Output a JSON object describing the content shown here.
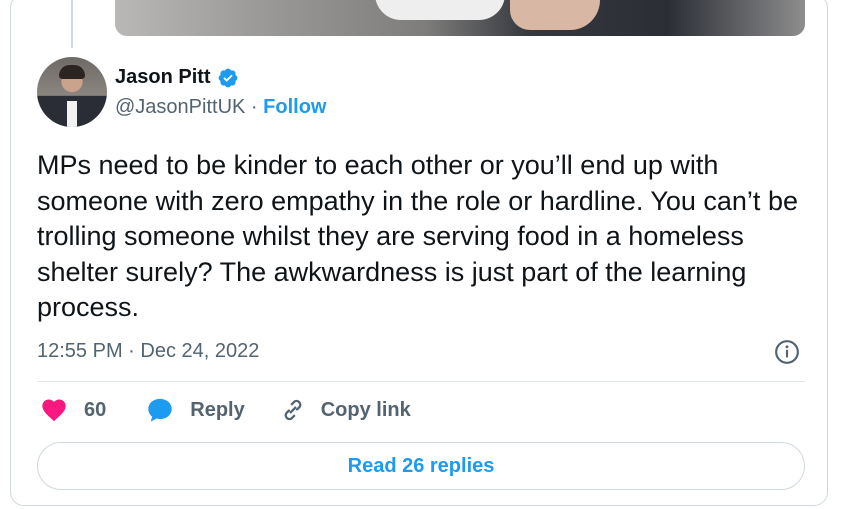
{
  "tweet": {
    "author_name": "Jason Pitt",
    "handle": "@JasonPittUK",
    "separator": " · ",
    "follow_label": "Follow",
    "text": "MPs need to be kinder to each other or you’ll end up with someone with zero empathy in the role or hardline. You can’t be trolling someone whilst they are serving food in a homeless shelter surely? The awkwardness is just part of the learning process.",
    "timestamp": "12:55 PM · Dec 24, 2022",
    "like_count": "60",
    "reply_label": "Reply",
    "copy_link_label": "Copy link",
    "read_replies_label": "Read 26 replies"
  },
  "colors": {
    "accent": "#1d9bf0",
    "like": "#f91880",
    "muted_text": "#536471",
    "border": "#cfd9de"
  },
  "icons": [
    "verified-badge-icon",
    "info-icon",
    "heart-icon",
    "reply-bubble-icon",
    "link-icon"
  ]
}
